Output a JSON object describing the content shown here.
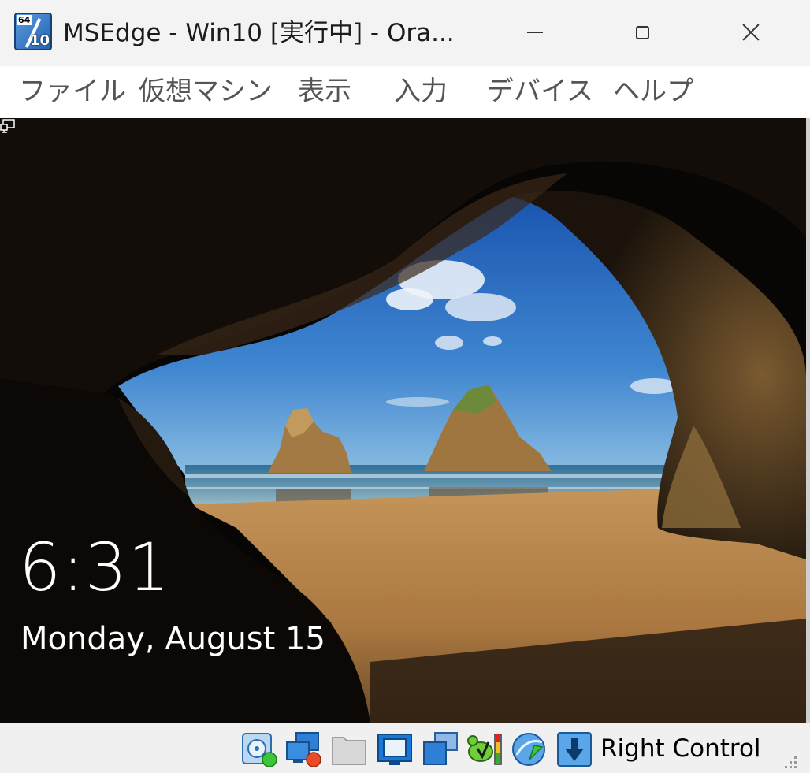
{
  "window": {
    "title": "MSEdge - Win10 [実行中] - Ora...",
    "icon_name": "virtualbox-win10-64-icon",
    "icon_badge_top": "64",
    "icon_badge_bottom": "10"
  },
  "menu": {
    "items": [
      {
        "label": "ファイル"
      },
      {
        "label": "仮想マシン"
      },
      {
        "label": "表示"
      },
      {
        "label": "入力"
      },
      {
        "label": "デバイス"
      },
      {
        "label": "ヘルプ"
      }
    ]
  },
  "lockscreen": {
    "time": "6:31",
    "date": "Monday, August 15",
    "network_icon": "network-icon"
  },
  "statusbar": {
    "icons": [
      {
        "name": "optical-drive-icon"
      },
      {
        "name": "network-adapter-icon"
      },
      {
        "name": "shared-folder-icon"
      },
      {
        "name": "display-icon"
      },
      {
        "name": "video-capture-icon"
      },
      {
        "name": "cpu-activity-icon"
      },
      {
        "name": "mouse-integration-icon"
      },
      {
        "name": "keyboard-capture-icon"
      }
    ],
    "host_key": "Right Control"
  },
  "colors": {
    "titlebar_bg": "#f3f3f3",
    "menubar_bg": "#ffffff",
    "statusbar_bg": "#f0f0f0",
    "sky_top": "#1f5fb8",
    "sky_bottom": "#6fa9d8",
    "sand": "#b8874f",
    "rock": "#2b1f14"
  }
}
